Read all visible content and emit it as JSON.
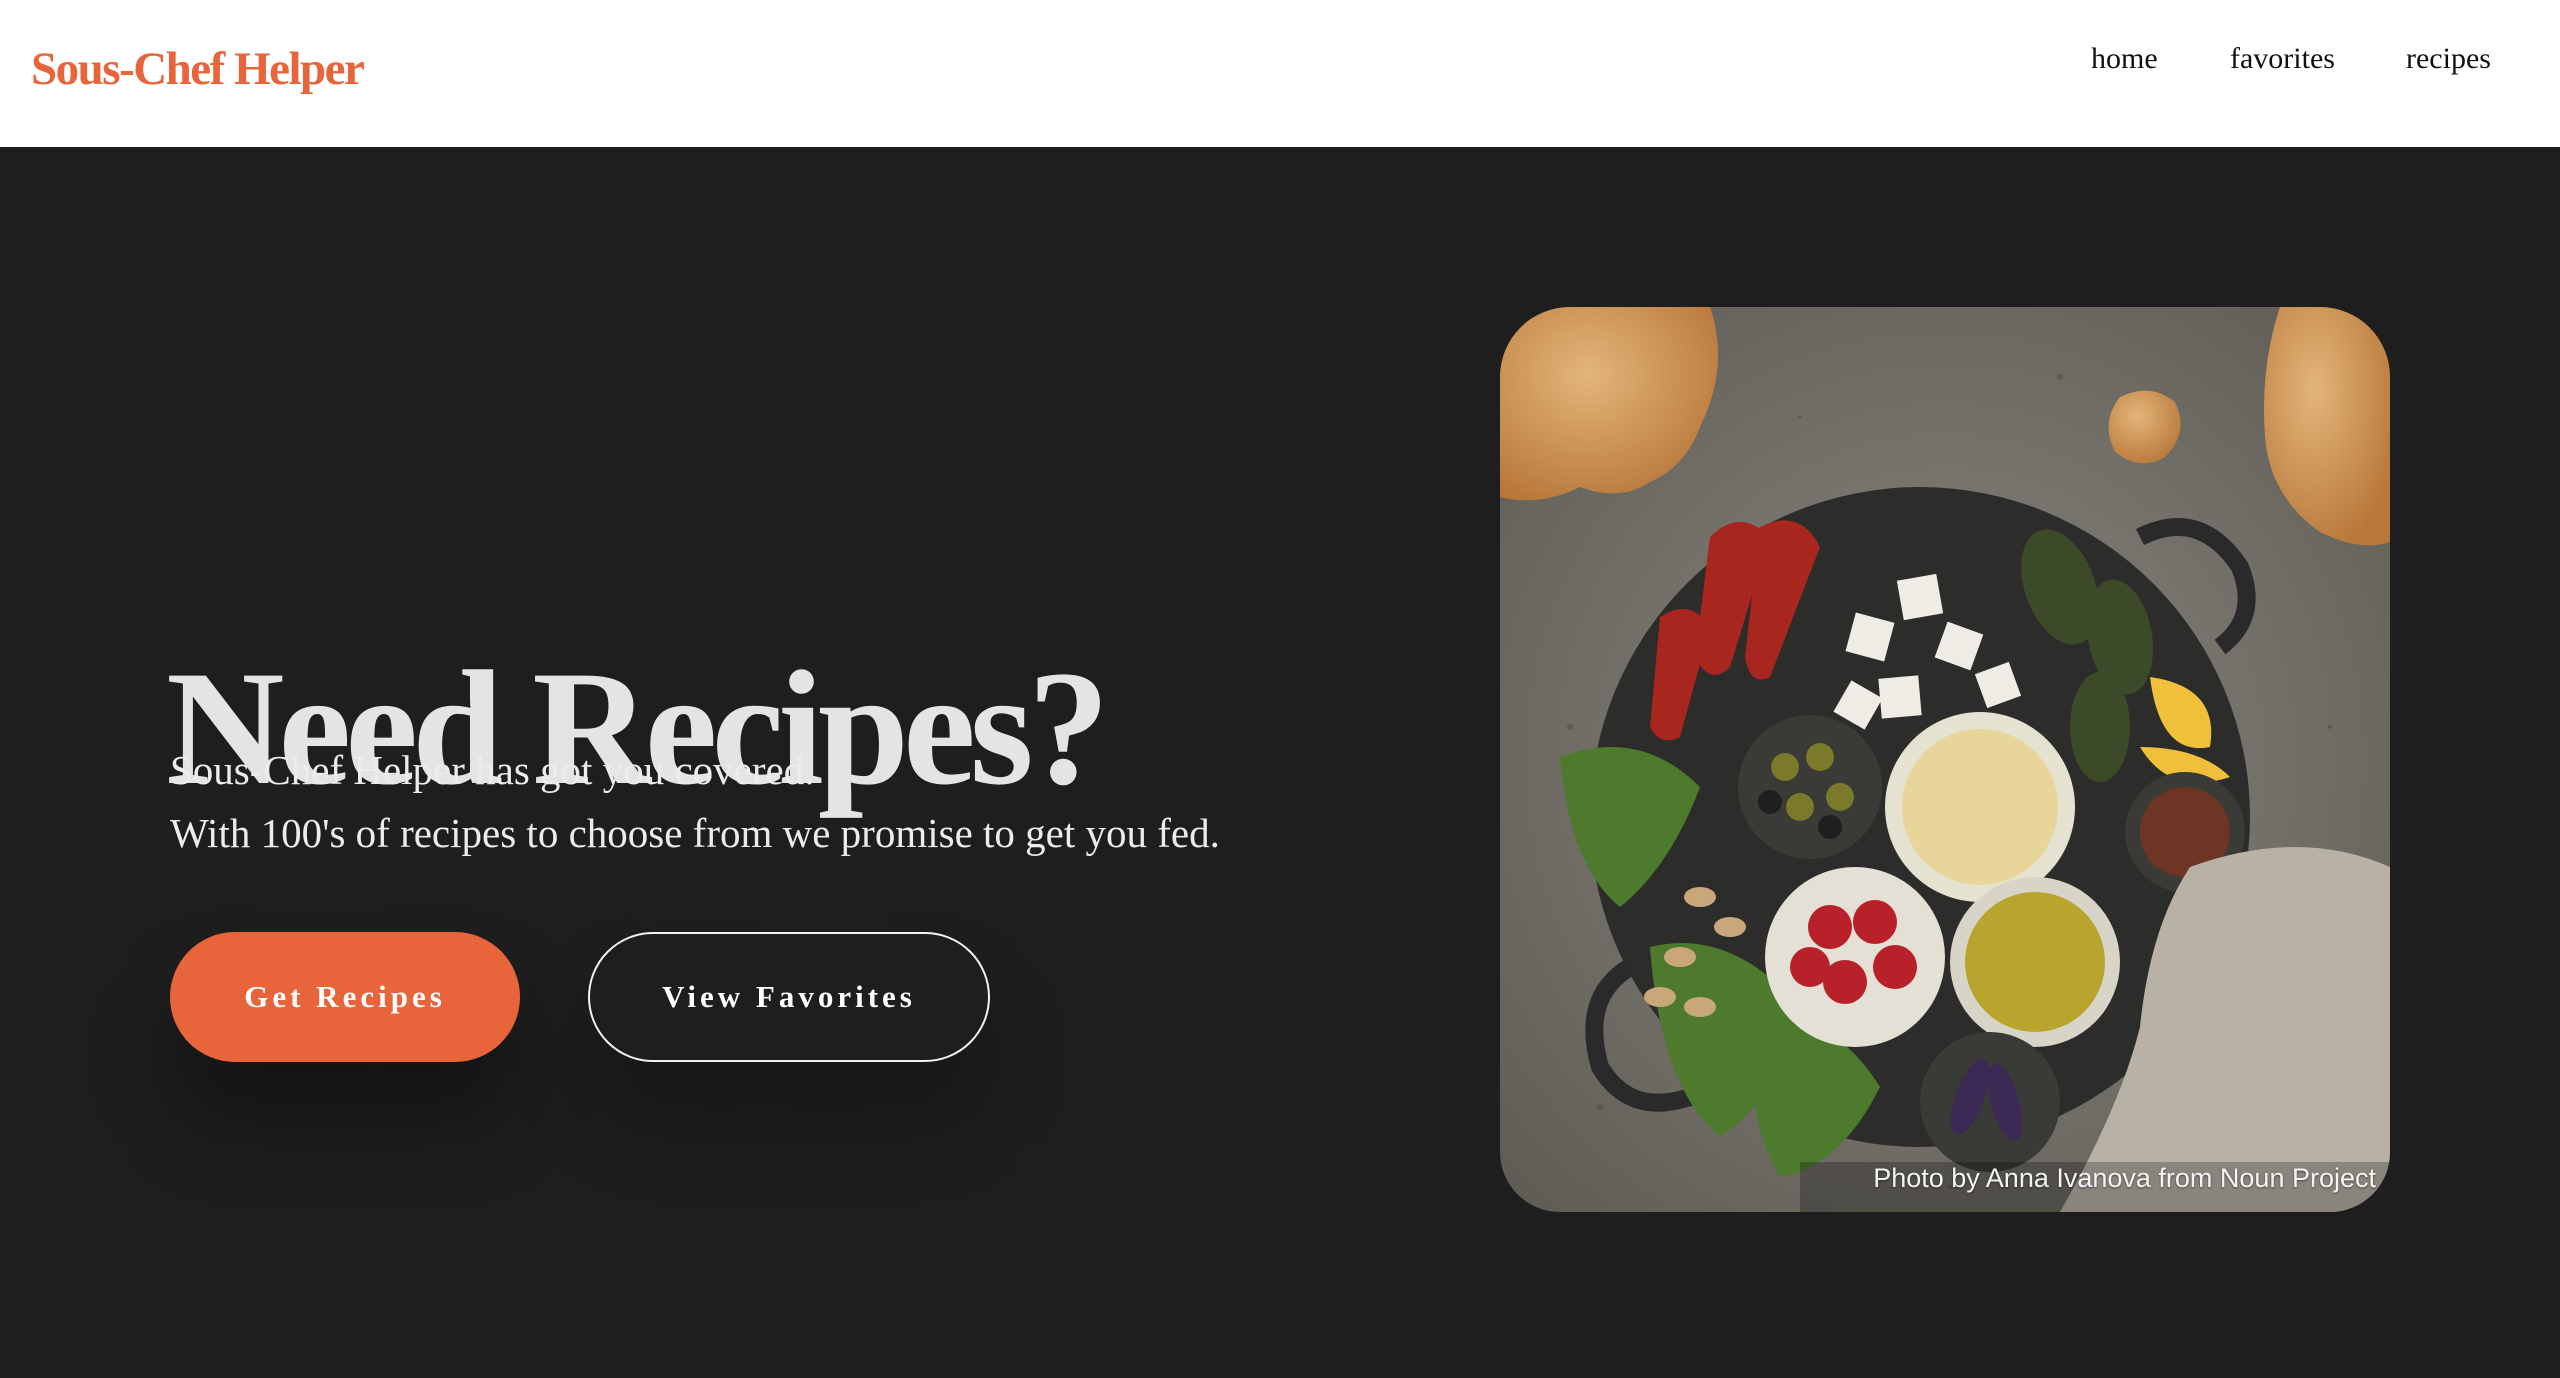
{
  "nav": {
    "brand": "Sous-Chef Helper",
    "links": [
      "home",
      "favorites",
      "recipes"
    ]
  },
  "hero": {
    "headline": "Need Recipes?",
    "subtitle_lines": [
      "Sous-Chef Helper has got you covered.",
      "With 100's of recipes to choose from we promise to get you fed."
    ],
    "buttons": {
      "primary": "Get Recipes",
      "secondary": "View Favorites"
    },
    "image": {
      "icon": "food-platter-photo",
      "credit": "Photo by Anna Ivanova from Noun Project"
    }
  },
  "colors": {
    "accent": "#e8643a",
    "background": "#1e1e1e",
    "navbar": "#ffffff"
  }
}
